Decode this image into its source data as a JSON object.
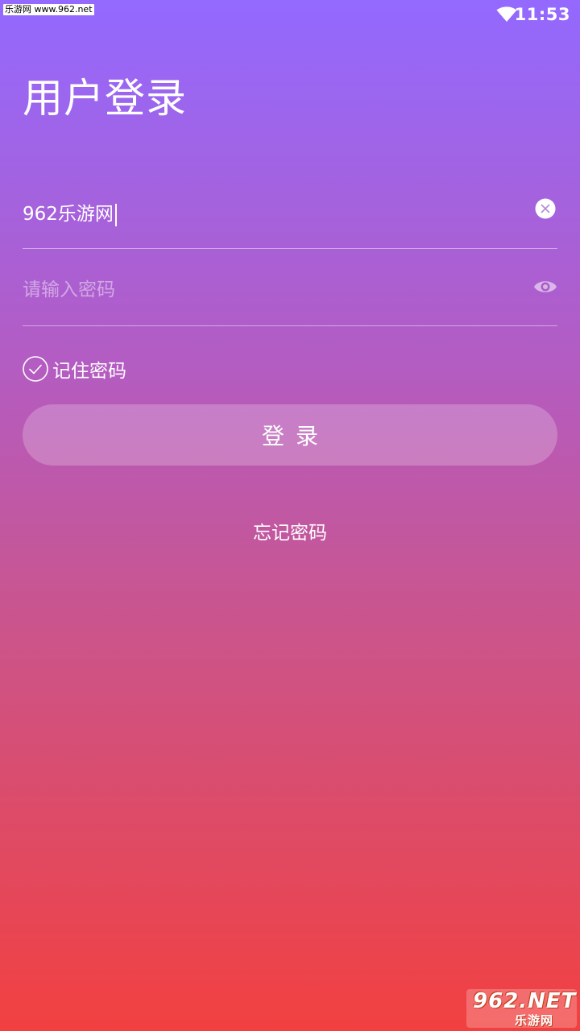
{
  "status_bar": {
    "watermark": "乐游网 www.962.net",
    "time": "11:53",
    "wifi_icon": "wifi-icon"
  },
  "title": "用户登录",
  "username": {
    "value": "962乐游网",
    "clear_icon": "clear-icon"
  },
  "password": {
    "placeholder": "请输入密码",
    "toggle_icon": "eye-icon"
  },
  "remember": {
    "label": "记住密码",
    "checked": true
  },
  "login_button": "登录",
  "forgot_link": "忘记密码",
  "watermark": {
    "brand": "962.NET",
    "name": "乐游网"
  }
}
